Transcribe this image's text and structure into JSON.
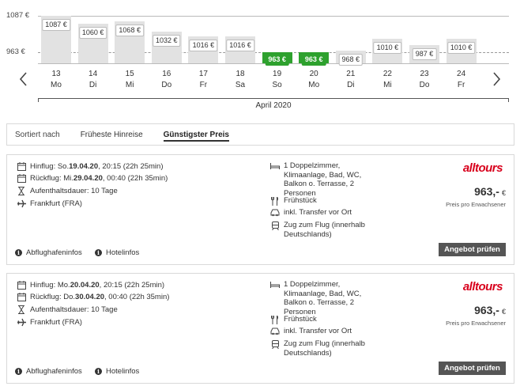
{
  "chart": {
    "y_max_label": "1087 €",
    "y_min_label": "963 €",
    "month_label": "April 2020",
    "prev_icon": "chevron-left-icon",
    "next_icon": "chevron-right-icon",
    "best_color": "#2ea12e",
    "days": [
      {
        "num": "13",
        "wd": "Mo",
        "price": "1087 €",
        "value": 1087,
        "best": false
      },
      {
        "num": "14",
        "wd": "Di",
        "price": "1060 €",
        "value": 1060,
        "best": false
      },
      {
        "num": "15",
        "wd": "Mi",
        "price": "1068 €",
        "value": 1068,
        "best": false
      },
      {
        "num": "16",
        "wd": "Do",
        "price": "1032 €",
        "value": 1032,
        "best": false
      },
      {
        "num": "17",
        "wd": "Fr",
        "price": "1016 €",
        "value": 1016,
        "best": false
      },
      {
        "num": "18",
        "wd": "Sa",
        "price": "1016 €",
        "value": 1016,
        "best": false
      },
      {
        "num": "19",
        "wd": "So",
        "price": "963 €",
        "value": 963,
        "best": true
      },
      {
        "num": "20",
        "wd": "Mo",
        "price": "963 €",
        "value": 963,
        "best": true
      },
      {
        "num": "21",
        "wd": "Di",
        "price": "968 €",
        "value": 968,
        "best": false
      },
      {
        "num": "22",
        "wd": "Mi",
        "price": "1010 €",
        "value": 1010,
        "best": false
      },
      {
        "num": "23",
        "wd": "Do",
        "price": "987 €",
        "value": 987,
        "best": false
      },
      {
        "num": "24",
        "wd": "Fr",
        "price": "1010 €",
        "value": 1010,
        "best": false
      }
    ]
  },
  "sort": {
    "label": "Sortiert nach",
    "tabs": [
      {
        "label": "Früheste Hinreise",
        "active": false
      },
      {
        "label": "Günstigster Preis",
        "active": true
      }
    ]
  },
  "offers": [
    {
      "outbound_prefix": "Hinflug: So. ",
      "outbound_date": "19.04.20",
      "outbound_suffix": ", 20:15 (22h 25min)",
      "return_prefix": "Rückflug: Mi. ",
      "return_date": "29.04.20",
      "return_suffix": ", 00:40 (22h 35min)",
      "duration": "Aufenthaltsdauer: 10 Tage",
      "airport": "Frankfurt (FRA)",
      "room": "1 Doppelzimmer, Klimaanlage, Bad, WC, Balkon o. Terrasse, 2 Personen",
      "board": "Frühstück",
      "transfer": "inkl. Transfer vor Ort",
      "train": "Zug zum Flug (innerhalb Deutschlands)",
      "brand": "alltours",
      "price": "963,-",
      "currency": "€",
      "price_note": "Preis pro Erwachsener",
      "airport_info": "Abflughafeninfos",
      "hotel_info": "Hotelinfos",
      "cta": "Angebot prüfen"
    },
    {
      "outbound_prefix": "Hinflug: Mo. ",
      "outbound_date": "20.04.20",
      "outbound_suffix": ", 20:15 (22h 25min)",
      "return_prefix": "Rückflug: Do. ",
      "return_date": "30.04.20",
      "return_suffix": ", 00:40 (22h 35min)",
      "duration": "Aufenthaltsdauer: 10 Tage",
      "airport": "Frankfurt (FRA)",
      "room": "1 Doppelzimmer, Klimaanlage, Bad, WC, Balkon o. Terrasse, 2 Personen",
      "board": "Frühstück",
      "transfer": "inkl. Transfer vor Ort",
      "train": "Zug zum Flug (innerhalb Deutschlands)",
      "brand": "alltours",
      "price": "963,-",
      "currency": "€",
      "price_note": "Preis pro Erwachsener",
      "airport_info": "Abflughafeninfos",
      "hotel_info": "Hotelinfos",
      "cta": "Angebot prüfen"
    }
  ]
}
